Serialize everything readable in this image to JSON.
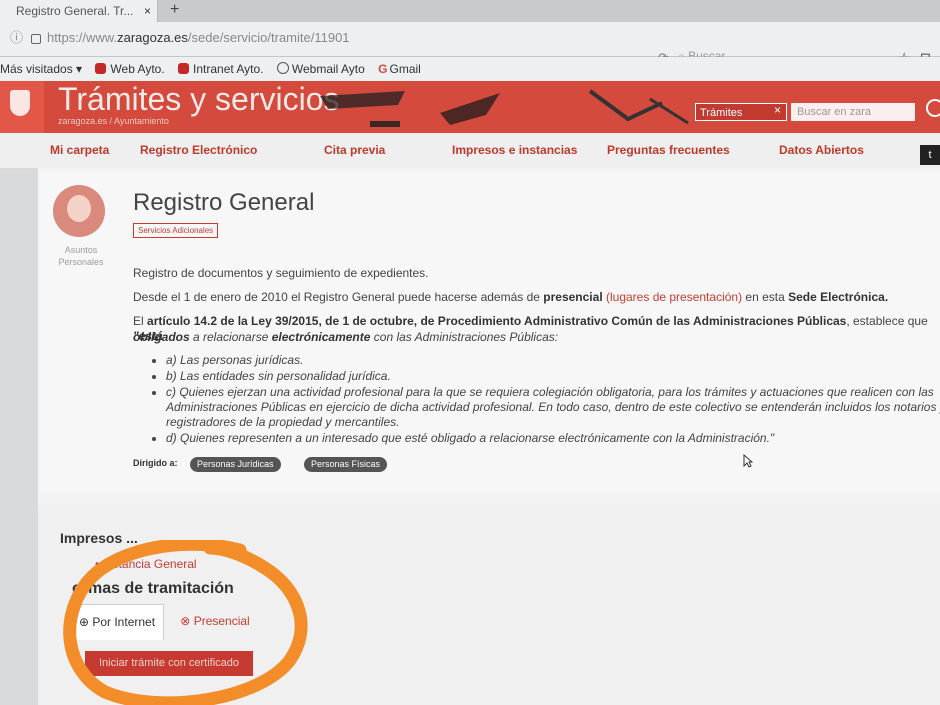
{
  "browser": {
    "tab_title": "Registro General. Tr...",
    "tab_close": "×",
    "new_tab": "+",
    "url_prefix": "https://www.",
    "url_domain": "zaragoza.es",
    "url_path": "/sede/servicio/tramite/11901",
    "search_placeholder": "Buscar",
    "star": "☆",
    "library": "⊡",
    "reload": "⟳"
  },
  "bookmarks": [
    {
      "label": "Más visitados"
    },
    {
      "label": "Web Ayto."
    },
    {
      "label": "Intranet Ayto."
    },
    {
      "label": "Webmail Ayto"
    },
    {
      "label": "Gmail"
    }
  ],
  "banner": {
    "title": "Trámites y servicios",
    "breadcrumb": "zaragoza.es  /  Ayuntamiento",
    "search_scope": "Trámites",
    "search_clear": "×",
    "search_placeholder": "Buscar en zara"
  },
  "nav": {
    "items": [
      {
        "label": "Mi carpeta"
      },
      {
        "label": "Registro Electrónico"
      },
      {
        "label": "Cita previa"
      },
      {
        "label": "Impresos e instancias"
      },
      {
        "label": "Preguntas frecuentes"
      },
      {
        "label": "Datos Abiertos"
      }
    ],
    "twitter": "t"
  },
  "sidebar": {
    "avatar_label": "Asuntos Personales"
  },
  "main": {
    "title": "Registro General",
    "tag": "Servicios Adicionales",
    "desc1": "Registro de documentos y seguimiento de expedientes.",
    "desc2_pre": "Desde el 1 de enero de 2010 el Registro General puede hacerse además de ",
    "desc2_bold": "presencial",
    "desc2_link": "(lugares de presentación)",
    "desc2_post": " en esta ",
    "desc2_bold2": "Sede Electrónica.",
    "law_pre": "El ",
    "law_bold": "artículo 14.2 de la Ley 39/2015, de 1 de octubre, de Procedimiento Administrativo Común de las Administraciones Públicas",
    "law_mid": ", establece que ",
    "law_quote": "\"está",
    "law2_bold": "obligados",
    "law2_mid": " a relacionarse ",
    "law2_bold2": "electrónicamente",
    "law2_post": " con las Administraciones Públicas:",
    "bullets": [
      "a) Las personas jurídicas.",
      "b) Las entidades sin personalidad jurídica.",
      "c) Quienes ejerzan una actividad profesional para la que se requiera colegiación obligatoria, para los trámites y actuaciones que realicen con las Administraciones Públicas en ejercicio de dicha actividad profesional. En todo caso, dentro de este colectivo se entenderán incluidos los notarios y registradores de la propiedad y mercantiles.",
      "d) Quienes representen a un interesado que esté obligado a relacionarse electrónicamente con la Administración.\""
    ],
    "dirigido_label": "Dirigido a:",
    "pills": [
      "Personas Jurídicas",
      "Personas Físicas"
    ]
  },
  "bottom": {
    "impresos_title": "Impresos ...",
    "instancia": "Instancia General",
    "formas_title": "ormas de tramitación",
    "tab_internet": "Por Internet",
    "tab_presencial": "Presencial",
    "iniciar_label": "Iniciar trámite con certificado"
  },
  "colors": {
    "accent": "#cc3b30",
    "banner": "#d44a3d",
    "annotation": "#f28d2a"
  }
}
